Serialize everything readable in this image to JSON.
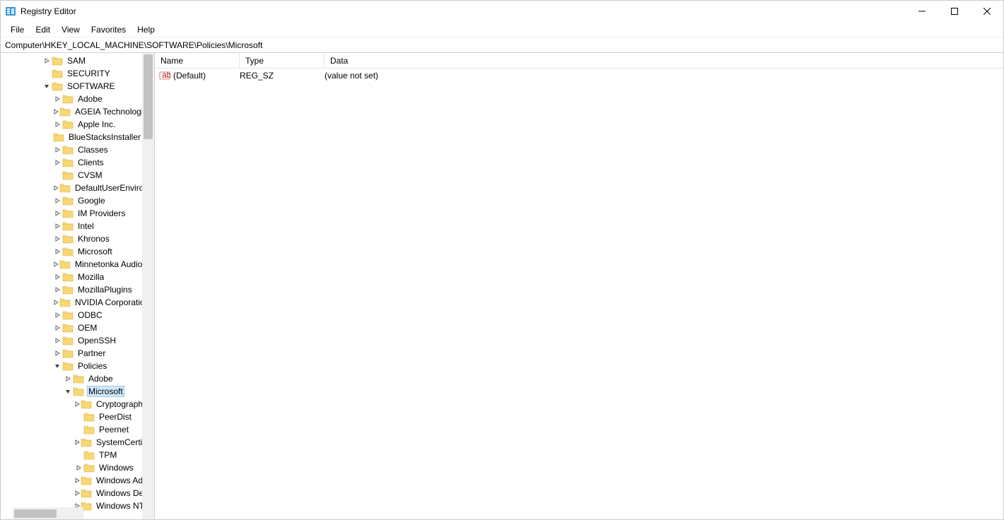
{
  "window": {
    "title": "Registry Editor"
  },
  "menu": {
    "file": "File",
    "edit": "Edit",
    "view": "View",
    "favorites": "Favorites",
    "help": "Help"
  },
  "address": {
    "path": "Computer\\HKEY_LOCAL_MACHINE\\SOFTWARE\\Policies\\Microsoft"
  },
  "tree": [
    {
      "depth": 2,
      "chev": "closed",
      "label": "SAM"
    },
    {
      "depth": 2,
      "chev": "none",
      "label": "SECURITY"
    },
    {
      "depth": 2,
      "chev": "open",
      "label": "SOFTWARE"
    },
    {
      "depth": 3,
      "chev": "closed",
      "label": "Adobe"
    },
    {
      "depth": 3,
      "chev": "closed",
      "label": "AGEIA Technologies"
    },
    {
      "depth": 3,
      "chev": "closed",
      "label": "Apple Inc."
    },
    {
      "depth": 3,
      "chev": "none",
      "label": "BlueStacksInstaller"
    },
    {
      "depth": 3,
      "chev": "closed",
      "label": "Classes"
    },
    {
      "depth": 3,
      "chev": "closed",
      "label": "Clients"
    },
    {
      "depth": 3,
      "chev": "none",
      "label": "CVSM"
    },
    {
      "depth": 3,
      "chev": "closed",
      "label": "DefaultUserEnvironment"
    },
    {
      "depth": 3,
      "chev": "closed",
      "label": "Google"
    },
    {
      "depth": 3,
      "chev": "closed",
      "label": "IM Providers"
    },
    {
      "depth": 3,
      "chev": "closed",
      "label": "Intel"
    },
    {
      "depth": 3,
      "chev": "closed",
      "label": "Khronos"
    },
    {
      "depth": 3,
      "chev": "closed",
      "label": "Microsoft"
    },
    {
      "depth": 3,
      "chev": "closed",
      "label": "Minnetonka Audio Software"
    },
    {
      "depth": 3,
      "chev": "closed",
      "label": "Mozilla"
    },
    {
      "depth": 3,
      "chev": "closed",
      "label": "MozillaPlugins"
    },
    {
      "depth": 3,
      "chev": "closed",
      "label": "NVIDIA Corporation"
    },
    {
      "depth": 3,
      "chev": "closed",
      "label": "ODBC"
    },
    {
      "depth": 3,
      "chev": "closed",
      "label": "OEM"
    },
    {
      "depth": 3,
      "chev": "closed",
      "label": "OpenSSH"
    },
    {
      "depth": 3,
      "chev": "closed",
      "label": "Partner"
    },
    {
      "depth": 3,
      "chev": "open",
      "label": "Policies"
    },
    {
      "depth": 4,
      "chev": "closed",
      "label": "Adobe"
    },
    {
      "depth": 4,
      "chev": "open",
      "label": "Microsoft",
      "selected": true
    },
    {
      "depth": 5,
      "chev": "closed",
      "label": "Cryptography"
    },
    {
      "depth": 5,
      "chev": "none",
      "label": "PeerDist"
    },
    {
      "depth": 5,
      "chev": "none",
      "label": "Peernet"
    },
    {
      "depth": 5,
      "chev": "closed",
      "label": "SystemCertificates"
    },
    {
      "depth": 5,
      "chev": "none",
      "label": "TPM"
    },
    {
      "depth": 5,
      "chev": "closed",
      "label": "Windows"
    },
    {
      "depth": 5,
      "chev": "closed",
      "label": "Windows Advanced Threat Protection"
    },
    {
      "depth": 5,
      "chev": "closed",
      "label": "Windows Defender"
    },
    {
      "depth": 5,
      "chev": "closed",
      "label": "Windows NT"
    }
  ],
  "values": {
    "headers": {
      "name": "Name",
      "type": "Type",
      "data": "Data"
    },
    "rows": [
      {
        "name": "(Default)",
        "type": "REG_SZ",
        "data": "(value not set)"
      }
    ]
  }
}
